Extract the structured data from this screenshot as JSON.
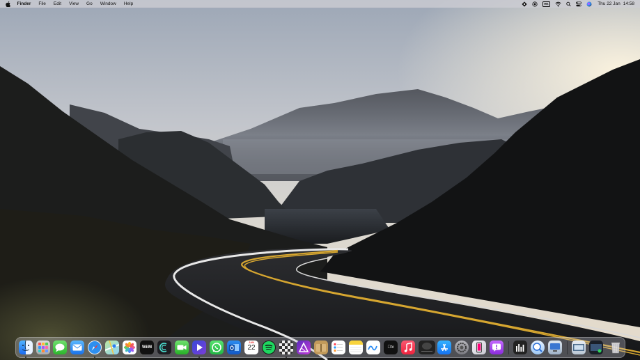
{
  "menubar": {
    "app_name": "Finder",
    "menus": [
      "File",
      "Edit",
      "View",
      "Go",
      "Window",
      "Help"
    ],
    "status_icons": [
      "dropbox-icon",
      "screen-record-icon",
      "input-source-icon",
      "wifi-icon",
      "spotlight-search-icon",
      "control-center-icon",
      "siri-icon"
    ],
    "input_source": "HK",
    "date": "Thu 22 Jan",
    "time": "14:58"
  },
  "dock": {
    "apps": [
      {
        "name": "Finder",
        "icon": "finder-icon",
        "running": true
      },
      {
        "name": "Launchpad",
        "icon": "launchpad-icon",
        "running": false
      },
      {
        "name": "Messages",
        "icon": "messages-icon",
        "running": false
      },
      {
        "name": "Mail",
        "icon": "mail-icon",
        "running": false
      },
      {
        "name": "Safari",
        "icon": "safari-icon",
        "running": true
      },
      {
        "name": "Maps",
        "icon": "maps-icon",
        "running": false
      },
      {
        "name": "Photos",
        "icon": "photos-icon",
        "running": false
      },
      {
        "name": "WiiM Home",
        "icon": "wiim-icon",
        "running": false,
        "label": "WiiM"
      },
      {
        "name": "Podcasts Alt",
        "icon": "audio-app-icon",
        "running": false
      },
      {
        "name": "FaceTime",
        "icon": "facetime-icon",
        "running": false
      },
      {
        "name": "Infuse",
        "icon": "infuse-icon",
        "running": true
      },
      {
        "name": "WhatsApp",
        "icon": "whatsapp-icon",
        "running": false
      },
      {
        "name": "Outlook",
        "icon": "outlook-icon",
        "running": false
      },
      {
        "name": "Calendar",
        "icon": "calendar-icon",
        "running": false,
        "month": "JAN",
        "day": "22"
      },
      {
        "name": "Spotify",
        "icon": "spotify-icon",
        "running": false
      },
      {
        "name": "Chess",
        "icon": "chess-icon",
        "running": true
      },
      {
        "name": "Affinity Designer",
        "icon": "affinity-icon",
        "running": false
      },
      {
        "name": "Archive Utility",
        "icon": "archive-icon",
        "running": false
      },
      {
        "name": "Reminders",
        "icon": "reminders-icon",
        "running": false
      },
      {
        "name": "Notes",
        "icon": "notes-icon",
        "running": false
      },
      {
        "name": "Freeform",
        "icon": "freeform-icon",
        "running": false
      },
      {
        "name": "Apple TV",
        "icon": "appletv-icon",
        "running": false,
        "label": "tv"
      },
      {
        "name": "Music",
        "icon": "music-icon",
        "running": false
      },
      {
        "name": "Screensaver",
        "icon": "screensaver-icon",
        "running": false
      },
      {
        "name": "App Store",
        "icon": "appstore-icon",
        "running": false
      },
      {
        "name": "System Settings",
        "icon": "settings-icon",
        "running": false
      },
      {
        "name": "Phone Mirroring",
        "icon": "phone-mirroring-icon",
        "running": false
      },
      {
        "name": "Feedback",
        "icon": "feedback-icon",
        "running": false
      },
      {
        "name": "Audio Hijack",
        "icon": "audio-meter-icon",
        "running": false
      },
      {
        "name": "Preview",
        "icon": "preview-icon",
        "running": false
      },
      {
        "name": "Screen Sharing",
        "icon": "screen-sharing-icon",
        "running": false
      },
      {
        "name": "Downloads Stack",
        "icon": "downloads-stack-icon",
        "running": false
      },
      {
        "name": "Terminal Stack",
        "icon": "desktop-stack-icon",
        "running": false
      },
      {
        "name": "Trash",
        "icon": "trash-icon",
        "running": false
      }
    ]
  }
}
